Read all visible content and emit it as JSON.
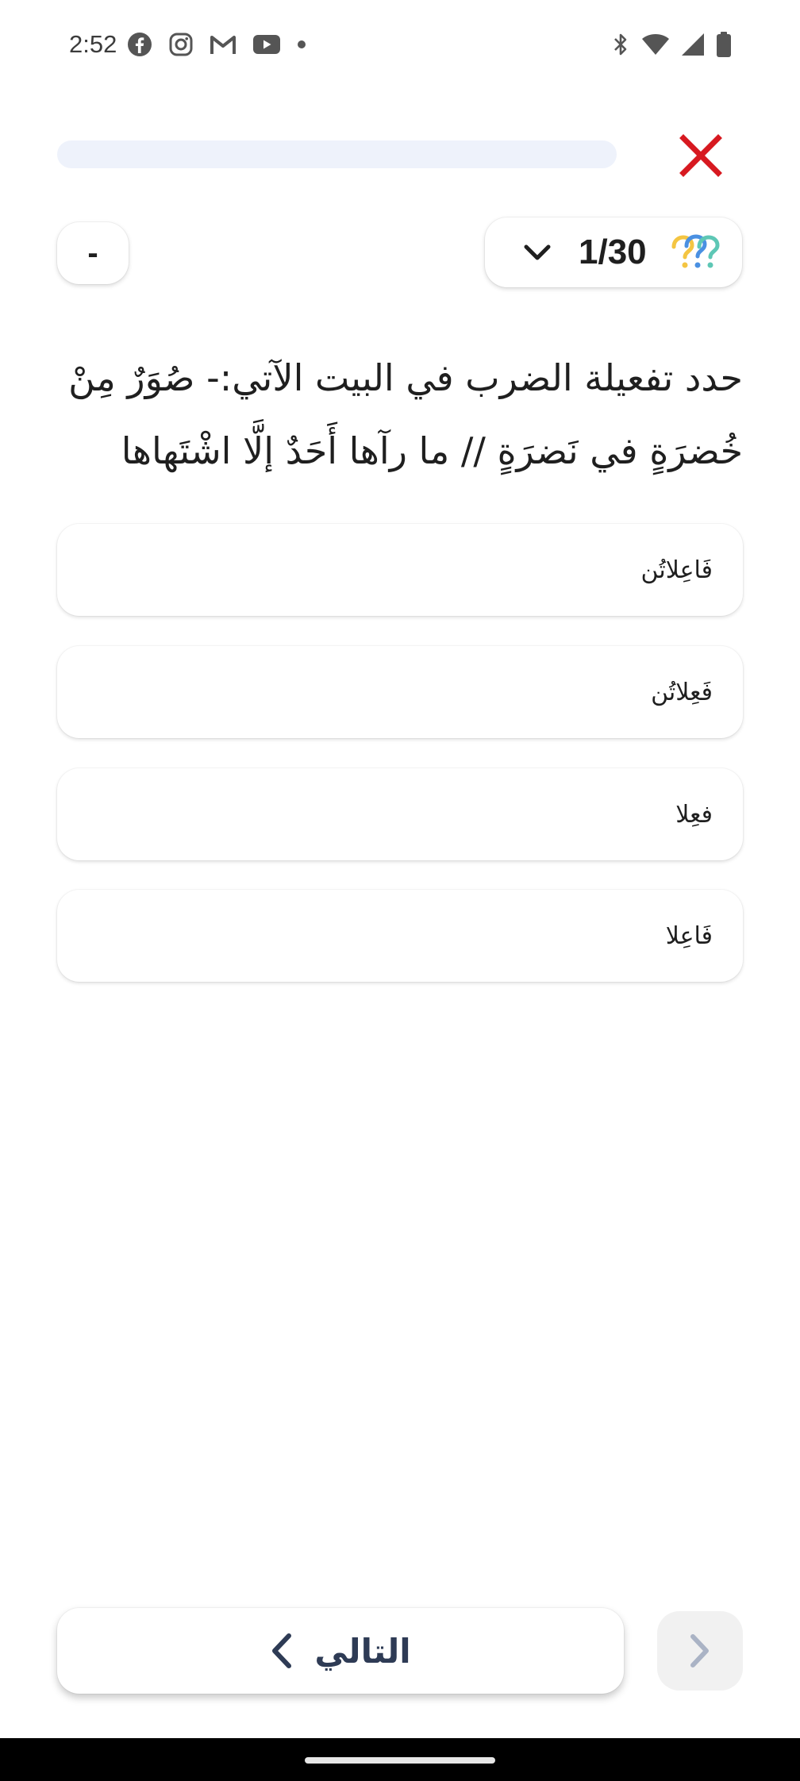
{
  "status_bar": {
    "time": "2:52",
    "left_icons": [
      "facebook-icon",
      "instagram-icon",
      "gmail-icon",
      "youtube-icon",
      "notification-dot-icon"
    ],
    "right_icons": [
      "bluetooth-icon",
      "wifi-icon",
      "cellular-signal-icon",
      "battery-icon"
    ]
  },
  "progress": {
    "value_percent": 0,
    "track_color": "#eef2fb",
    "fill_color": "#3f6fd8"
  },
  "close_button": {
    "icon": "close-icon",
    "color": "#d71920"
  },
  "minus_button": {
    "label": "-"
  },
  "counter": {
    "text": "1/30",
    "icon": "question-marks-icon"
  },
  "question": {
    "text": "حدد تفعيلة الضرب في البيت الآتي:- صُوَرٌ مِنْ خُضرَةٍ في نَضرَةٍ // ما رآها أَحَدٌ إلَّا اشْتَهاها"
  },
  "options": [
    {
      "label": "فَاعِلاتُن"
    },
    {
      "label": "فَعِلاتُن"
    },
    {
      "label": "فعِلا"
    },
    {
      "label": "فَاعِلا"
    }
  ],
  "next_button": {
    "label": "التالي",
    "icon": "chevron-left-icon",
    "text_color": "#2e3b55"
  },
  "forward_button": {
    "icon": "chevron-right-icon"
  }
}
